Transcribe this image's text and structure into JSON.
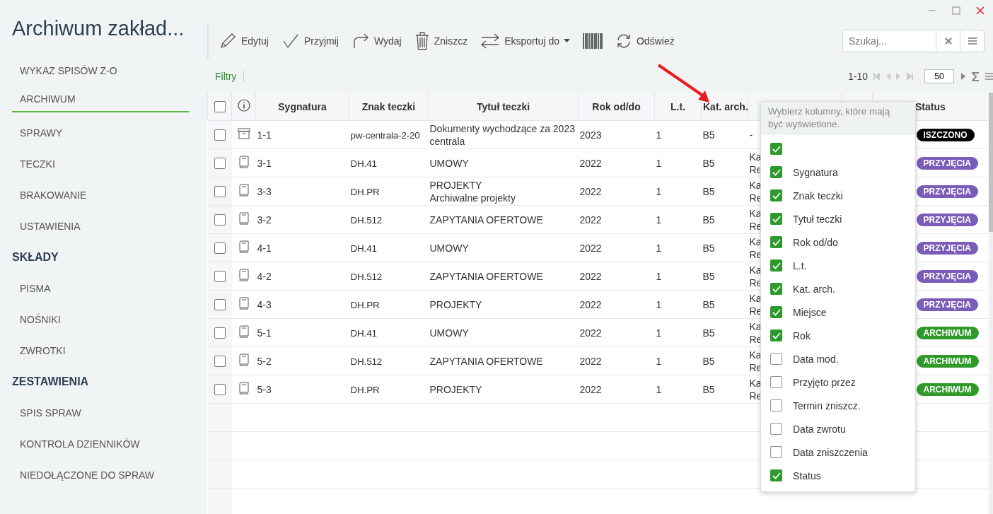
{
  "app": {
    "title": "Archiwum zakład..."
  },
  "sidebar": {
    "sections": [
      {
        "items": [
          {
            "label": "WYKAZ SPISÓW Z-O",
            "selected": false
          },
          {
            "label": "ARCHIWUM",
            "selected": true
          },
          {
            "label": "SPRAWY",
            "selected": false
          },
          {
            "label": "TECZKI",
            "selected": false
          },
          {
            "label": "BRAKOWANIE",
            "selected": false
          },
          {
            "label": "USTAWIENIA",
            "selected": false
          }
        ]
      },
      {
        "heading": "SKŁADY",
        "items": [
          {
            "label": "PISMA",
            "selected": false
          },
          {
            "label": "NOŚNIKI",
            "selected": false
          },
          {
            "label": "ZWROTKI",
            "selected": false
          }
        ]
      },
      {
        "heading": "ZESTAWIENIA",
        "items": [
          {
            "label": "SPIS SPRAW",
            "selected": false
          },
          {
            "label": "KONTROLA DZIENNIKÓW",
            "selected": false
          },
          {
            "label": "NIEDOŁĄCZONE DO SPRAW",
            "selected": false
          }
        ]
      }
    ]
  },
  "toolbar": [
    {
      "kind": "edit",
      "label": "Edytuj"
    },
    {
      "kind": "accept",
      "label": "Przyjmij"
    },
    {
      "kind": "issue",
      "label": "Wydaj"
    },
    {
      "kind": "destroy",
      "label": "Zniszcz"
    },
    {
      "kind": "export",
      "label": "Eksportuj do",
      "dropdown": true
    },
    {
      "kind": "barcode"
    },
    {
      "kind": "refresh",
      "label": "Odśwież"
    }
  ],
  "search": {
    "placeholder": "Szukaj..."
  },
  "filters": {
    "label": "Filtry"
  },
  "pagination": {
    "range": "1-10",
    "page_size": "50"
  },
  "table": {
    "select_all": {
      "checked": false
    },
    "columns": [
      {
        "label": "Sygnatura"
      },
      {
        "label": "Znak teczki"
      },
      {
        "label": "Tytuł teczki"
      },
      {
        "label": "Rok od/do"
      },
      {
        "label": "L.t."
      },
      {
        "label": "Kat. arch."
      },
      {},
      {},
      {
        "label": "Status"
      }
    ],
    "rows": [
      {
        "checked": false,
        "kind": "box",
        "sygnatura": "1-1",
        "znak": "pw-centrala-2-20",
        "tytul": [
          "Dokumenty wychodzące za 2023",
          "centrala"
        ],
        "rok": "2023",
        "lt": "1",
        "kat": "B5",
        "miejsce": [
          "-"
        ],
        "status": {
          "label": "ISZCZONO",
          "color": "#000000"
        }
      },
      {
        "checked": false,
        "sygnatura": "3-1",
        "kind": "book",
        "znak": "DH.41",
        "tytul": [
          "UMOWY"
        ],
        "rok": "2022",
        "lt": "1",
        "kat": "B5",
        "miejsce": [
          "Ka",
          "Re"
        ],
        "status": {
          "label": "PRZYJĘCIA",
          "color": "#7b5cb8"
        }
      },
      {
        "checked": false,
        "sygnatura": "3-3",
        "kind": "book",
        "znak": "DH.PR",
        "tytul": [
          "PROJEKTY",
          "Archiwalne projekty"
        ],
        "rok": "2022",
        "lt": "1",
        "kat": "B5",
        "miejsce": [
          "Ka",
          "Re"
        ],
        "status": {
          "label": "PRZYJĘCIA",
          "color": "#7b5cb8"
        }
      },
      {
        "checked": false,
        "sygnatura": "3-2",
        "kind": "book",
        "znak": "DH.512",
        "tytul": [
          "ZAPYTANIA OFERTOWE"
        ],
        "rok": "2022",
        "lt": "1",
        "kat": "B5",
        "miejsce": [
          "Ka",
          "Re"
        ],
        "status": {
          "label": "PRZYJĘCIA",
          "color": "#7b5cb8"
        }
      },
      {
        "checked": false,
        "sygnatura": "4-1",
        "kind": "book",
        "znak": "DH.41",
        "tytul": [
          "UMOWY"
        ],
        "rok": "2022",
        "lt": "1",
        "kat": "B5",
        "miejsce": [
          "Ka",
          "Re"
        ],
        "status": {
          "label": "PRZYJĘCIA",
          "color": "#7b5cb8"
        }
      },
      {
        "checked": false,
        "sygnatura": "4-2",
        "kind": "book",
        "znak": "DH.512",
        "tytul": [
          "ZAPYTANIA OFERTOWE"
        ],
        "rok": "2022",
        "lt": "1",
        "kat": "B5",
        "miejsce": [
          "Ka",
          "Re"
        ],
        "status": {
          "label": "PRZYJĘCIA",
          "color": "#7b5cb8"
        }
      },
      {
        "checked": false,
        "sygnatura": "4-3",
        "kind": "book",
        "znak": "DH.PR",
        "tytul": [
          "PROJEKTY"
        ],
        "rok": "2022",
        "lt": "1",
        "kat": "B5",
        "miejsce": [
          "Ka",
          "Re"
        ],
        "status": {
          "label": "PRZYJĘCIA",
          "color": "#7b5cb8"
        }
      },
      {
        "checked": false,
        "sygnatura": "5-1",
        "kind": "book",
        "znak": "DH.41",
        "tytul": [
          "UMOWY"
        ],
        "rok": "2022",
        "lt": "1",
        "kat": "B5",
        "miejsce": [
          "Ka",
          "Re"
        ],
        "status": {
          "label": "ARCHIWUM",
          "color": "#2f9a2a"
        }
      },
      {
        "checked": false,
        "sygnatura": "5-2",
        "kind": "book",
        "znak": "DH.512",
        "tytul": [
          "ZAPYTANIA OFERTOWE"
        ],
        "rok": "2022",
        "lt": "1",
        "kat": "B5",
        "miejsce": [
          "Ka",
          "Re"
        ],
        "status": {
          "label": "ARCHIWUM",
          "color": "#2f9a2a"
        }
      },
      {
        "checked": false,
        "sygnatura": "5-3",
        "kind": "book",
        "znak": "DH.PR",
        "tytul": [
          "PROJEKTY"
        ],
        "rok": "2022",
        "lt": "1",
        "kat": "B5",
        "miejsce": [
          "Ka",
          "Re"
        ],
        "status": {
          "label": "ARCHIWUM",
          "color": "#2f9a2a"
        }
      }
    ]
  },
  "column_picker": {
    "hint": "Wybierz kolumny, które mają być wyświetlone.",
    "items": [
      {
        "checked": true
      },
      {
        "label": "Sygnatura",
        "checked": true
      },
      {
        "label": "Znak teczki",
        "checked": true
      },
      {
        "label": "Tytuł teczki",
        "checked": true
      },
      {
        "label": "Rok od/do",
        "checked": true
      },
      {
        "label": "L.t.",
        "checked": true
      },
      {
        "label": "Kat. arch.",
        "checked": true
      },
      {
        "label": "Miejsce",
        "checked": true
      },
      {
        "label": "Rok",
        "checked": true
      },
      {
        "label": "Data mod.",
        "checked": false
      },
      {
        "label": "Przyjęto przez",
        "checked": false
      },
      {
        "label": "Termin zniszcz.",
        "checked": false
      },
      {
        "label": "Data zwrotu",
        "checked": false
      },
      {
        "label": "Data zniszczenia",
        "checked": false
      },
      {
        "label": "Status",
        "checked": true
      }
    ]
  }
}
